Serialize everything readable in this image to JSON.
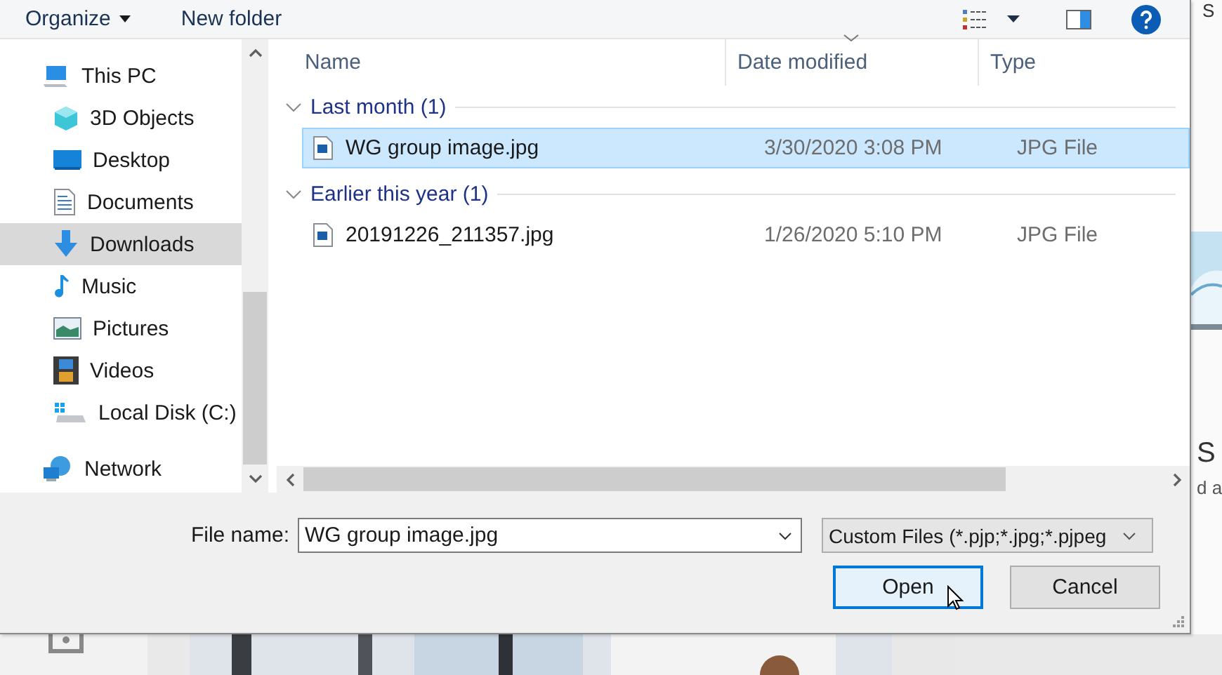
{
  "background": {
    "texts": [
      "S",
      "S",
      "d a"
    ]
  },
  "toolbar": {
    "organize": "Organize",
    "new_folder": "New folder"
  },
  "nav": {
    "items": [
      {
        "label": "This PC",
        "kind": "pc",
        "selected": false,
        "children": [
          {
            "label": "3D Objects",
            "kind": "cube",
            "selected": false
          },
          {
            "label": "Desktop",
            "kind": "desktop",
            "selected": false
          },
          {
            "label": "Documents",
            "kind": "documents",
            "selected": false
          },
          {
            "label": "Downloads",
            "kind": "downloads",
            "selected": true
          },
          {
            "label": "Music",
            "kind": "music",
            "selected": false
          },
          {
            "label": "Pictures",
            "kind": "pictures",
            "selected": false
          },
          {
            "label": "Videos",
            "kind": "videos",
            "selected": false
          },
          {
            "label": "Local Disk (C:)",
            "kind": "disk",
            "selected": false
          }
        ]
      },
      {
        "label": "Network",
        "kind": "network",
        "selected": false
      }
    ]
  },
  "columns": [
    {
      "label": "Name",
      "sorted": false
    },
    {
      "label": "Date modified",
      "sorted": true
    },
    {
      "label": "Type",
      "sorted": false
    }
  ],
  "groups": [
    {
      "label": "Last month (1)",
      "expanded": true,
      "files": [
        {
          "name": "WG group image.jpg",
          "date": "3/30/2020 3:08 PM",
          "type": "JPG File",
          "selected": true
        }
      ]
    },
    {
      "label": "Earlier this year (1)",
      "expanded": true,
      "files": [
        {
          "name": "20191226_211357.jpg",
          "date": "1/26/2020 5:10 PM",
          "type": "JPG File",
          "selected": false
        }
      ]
    }
  ],
  "file_name": {
    "label": "File name:",
    "value": "WG group image.jpg"
  },
  "file_type": "Custom Files (*.pjp;*.jpg;*.pjpeg",
  "buttons": [
    {
      "label": "Open",
      "focused": true
    },
    {
      "label": "Cancel",
      "focused": false
    }
  ]
}
